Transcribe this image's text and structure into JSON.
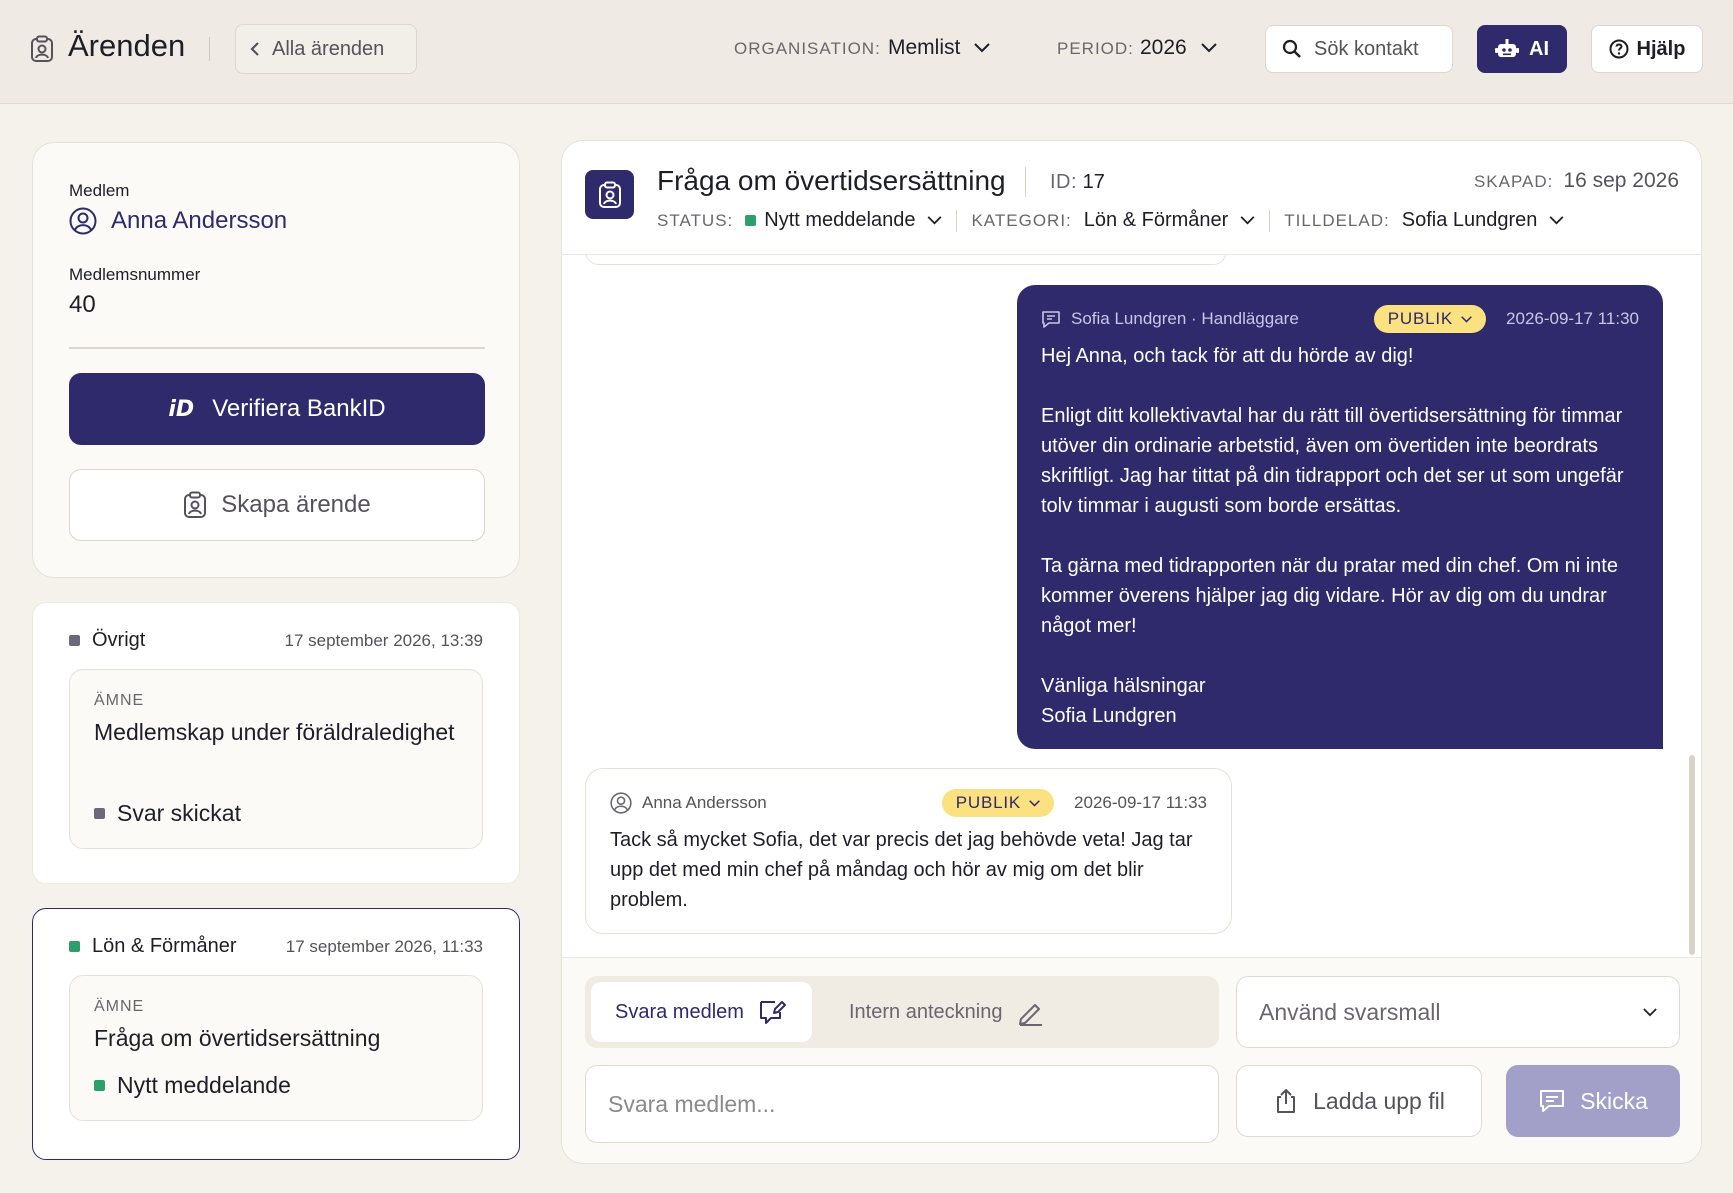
{
  "topbar": {
    "title": "Ärenden",
    "back_label": "Alla ärenden",
    "org_label": "ORGANISATION:",
    "org_value": "Memlist",
    "period_label": "PERIOD:",
    "period_value": "2026",
    "search_label": "Sök kontakt",
    "ai_label": "AI",
    "help_label": "Hjälp"
  },
  "member": {
    "name_label": "Medlem",
    "name": "Anna Andersson",
    "number_label": "Medlemsnummer",
    "number": "40",
    "bankid_label": "Verifiera BankID",
    "bankid_logo": "iD",
    "create_label": "Skapa ärende"
  },
  "cases": [
    {
      "category": "Övrigt",
      "category_color": "#6b6879",
      "date": "17 september 2026, 13:39",
      "subject_label": "ÄMNE",
      "subject": "Medlemskap under föräldraledighet",
      "status": "Svar skickat",
      "status_color": "#6b6879"
    },
    {
      "category": "Lön & Förmåner",
      "category_color": "#2e9e6b",
      "date": "17 september 2026, 11:33",
      "subject_label": "ÄMNE",
      "subject": "Fråga om övertidsersättning",
      "status": "Nytt meddelande",
      "status_color": "#2e9e6b"
    }
  ],
  "ticket": {
    "title": "Fråga om övertidsersättning",
    "id_label": "ID:",
    "id": "17",
    "created_label": "SKAPAD:",
    "created": "16 sep 2026",
    "status_label": "STATUS:",
    "status": "Nytt meddelande",
    "status_color": "#2e9e6b",
    "category_label": "KATEGORI:",
    "category": "Lön & Förmåner",
    "assigned_label": "TILLDELAD:",
    "assigned": "Sofia Lundgren"
  },
  "messages": [
    {
      "author": "Sofia Lundgren · Handläggare",
      "visibility": "PUBLIK",
      "time": "2026-09-17 11:30",
      "paragraphs": [
        "Hej Anna, och tack för att du hörde av dig!",
        "Enligt ditt kollektivavtal har du rätt till övertidsersättning för timmar utöver din ordinarie arbetstid, även om övertiden inte beordrats skriftligt. Jag har tittat på din tidrapport och det ser ut som ungefär tolv timmar i augusti som borde ersättas.",
        "Ta gärna med tidrapporten när du pratar med din chef. Om ni inte kommer överens hjälper jag dig vidare. Hör av dig om du undrar något mer!",
        "Vänliga hälsningar\nSofia Lundgren"
      ]
    },
    {
      "author": "Anna Andersson",
      "visibility": "PUBLIK",
      "time": "2026-09-17 11:33",
      "text": "Tack så mycket Sofia, det var precis det jag behövde veta! Jag tar upp det med min chef på måndag och hör av mig om det blir problem."
    }
  ],
  "composer": {
    "tab_reply": "Svara medlem",
    "tab_note": "Intern anteckning",
    "template_placeholder": "Använd svarsmall",
    "input_placeholder": "Svara medlem...",
    "upload_label": "Ladda upp fil",
    "send_label": "Skicka"
  },
  "colors": {
    "brand": "#2f2a6b",
    "badge": "#fbe17f",
    "background": "#f5f2ec"
  }
}
